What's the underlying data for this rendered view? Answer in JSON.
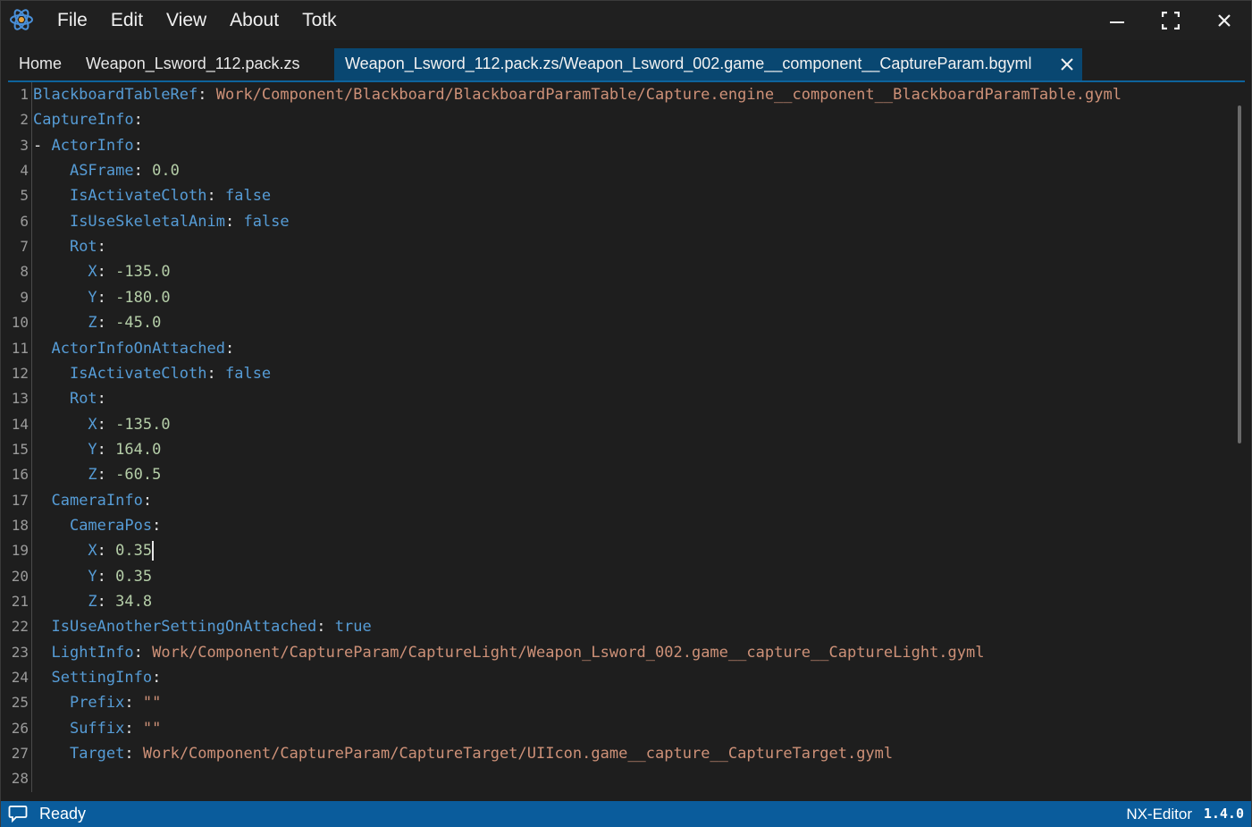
{
  "menu": {
    "items": [
      "File",
      "Edit",
      "View",
      "About",
      "Totk"
    ]
  },
  "tabs": {
    "home": "Home",
    "pack": "Weapon_Lsword_112.pack.zs",
    "active": "Weapon_Lsword_112.pack.zs/Weapon_Lsword_002.game__component__CaptureParam.bgyml"
  },
  "editor": {
    "lines": [
      {
        "n": "1",
        "indent": "",
        "key": "BlackboardTableRef",
        "val": "Work/Component/Blackboard/BlackboardParamTable/Capture.engine__component__BlackboardParamTable.gyml",
        "vt": "s"
      },
      {
        "n": "2",
        "indent": "",
        "key": "CaptureInfo",
        "val": "",
        "vt": ""
      },
      {
        "n": "3",
        "indent": "- ",
        "key": "ActorInfo",
        "val": "",
        "vt": ""
      },
      {
        "n": "4",
        "indent": "    ",
        "key": "ASFrame",
        "val": "0.0",
        "vt": "n"
      },
      {
        "n": "5",
        "indent": "    ",
        "key": "IsActivateCloth",
        "val": "false",
        "vt": "b"
      },
      {
        "n": "6",
        "indent": "    ",
        "key": "IsUseSkeletalAnim",
        "val": "false",
        "vt": "b"
      },
      {
        "n": "7",
        "indent": "    ",
        "key": "Rot",
        "val": "",
        "vt": ""
      },
      {
        "n": "8",
        "indent": "      ",
        "key": "X",
        "val": "-135.0",
        "vt": "n"
      },
      {
        "n": "9",
        "indent": "      ",
        "key": "Y",
        "val": "-180.0",
        "vt": "n"
      },
      {
        "n": "10",
        "indent": "      ",
        "key": "Z",
        "val": "-45.0",
        "vt": "n"
      },
      {
        "n": "11",
        "indent": "  ",
        "key": "ActorInfoOnAttached",
        "val": "",
        "vt": ""
      },
      {
        "n": "12",
        "indent": "    ",
        "key": "IsActivateCloth",
        "val": "false",
        "vt": "b"
      },
      {
        "n": "13",
        "indent": "    ",
        "key": "Rot",
        "val": "",
        "vt": ""
      },
      {
        "n": "14",
        "indent": "      ",
        "key": "X",
        "val": "-135.0",
        "vt": "n"
      },
      {
        "n": "15",
        "indent": "      ",
        "key": "Y",
        "val": "164.0",
        "vt": "n"
      },
      {
        "n": "16",
        "indent": "      ",
        "key": "Z",
        "val": "-60.5",
        "vt": "n"
      },
      {
        "n": "17",
        "indent": "  ",
        "key": "CameraInfo",
        "val": "",
        "vt": ""
      },
      {
        "n": "18",
        "indent": "    ",
        "key": "CameraPos",
        "val": "",
        "vt": ""
      },
      {
        "n": "19",
        "indent": "      ",
        "key": "X",
        "val": "0.35",
        "vt": "n",
        "caret": true
      },
      {
        "n": "20",
        "indent": "      ",
        "key": "Y",
        "val": "0.35",
        "vt": "n"
      },
      {
        "n": "21",
        "indent": "      ",
        "key": "Z",
        "val": "34.8",
        "vt": "n"
      },
      {
        "n": "22",
        "indent": "  ",
        "key": "IsUseAnotherSettingOnAttached",
        "val": "true",
        "vt": "b"
      },
      {
        "n": "23",
        "indent": "  ",
        "key": "LightInfo",
        "val": "Work/Component/CaptureParam/CaptureLight/Weapon_Lsword_002.game__capture__CaptureLight.gyml",
        "vt": "s"
      },
      {
        "n": "24",
        "indent": "  ",
        "key": "SettingInfo",
        "val": "",
        "vt": ""
      },
      {
        "n": "25",
        "indent": "    ",
        "key": "Prefix",
        "val": "\"\"",
        "vt": "s"
      },
      {
        "n": "26",
        "indent": "    ",
        "key": "Suffix",
        "val": "\"\"",
        "vt": "s"
      },
      {
        "n": "27",
        "indent": "    ",
        "key": "Target",
        "val": "Work/Component/CaptureParam/CaptureTarget/UIIcon.game__capture__CaptureTarget.gyml",
        "vt": "s"
      },
      {
        "n": "28",
        "indent": "",
        "key": "",
        "val": "",
        "vt": ""
      }
    ]
  },
  "statusbar": {
    "status": "Ready",
    "app_name": "NX-Editor",
    "version": "1.4.0"
  },
  "colors": {
    "accent": "#0a5c9c",
    "active_tab": "#094771",
    "key": "#569cd6",
    "string": "#ce9178",
    "number": "#b5cea8"
  }
}
